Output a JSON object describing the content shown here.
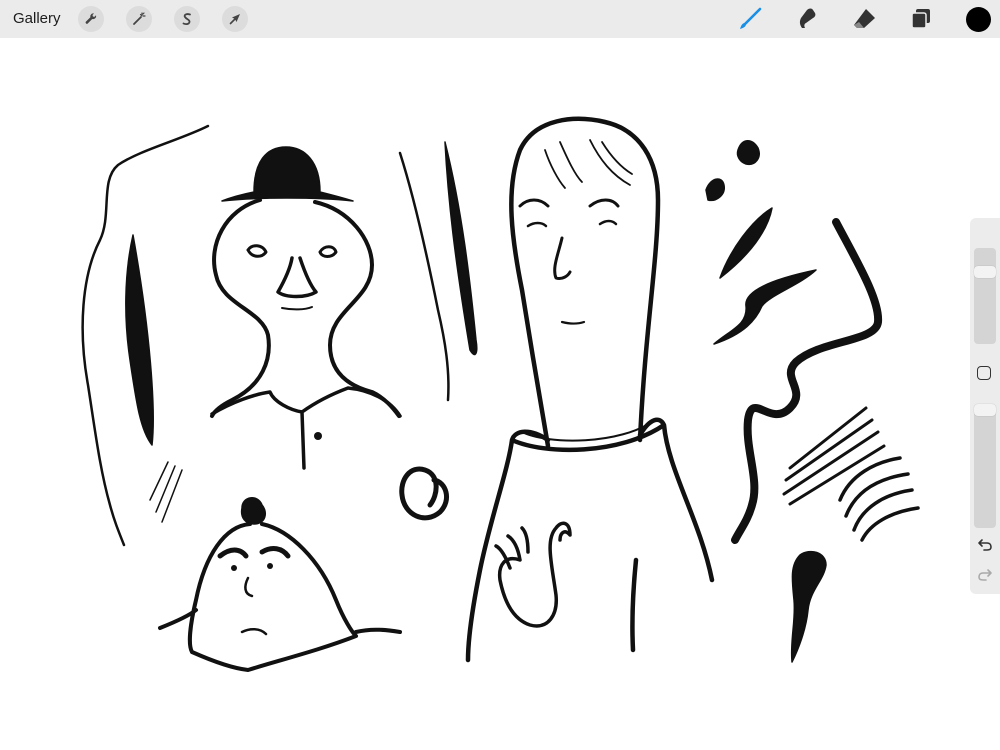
{
  "topbar": {
    "gallery_label": "Gallery",
    "left_tools": [
      {
        "name": "actions",
        "icon": "wrench-icon"
      },
      {
        "name": "adjustments",
        "icon": "magic-wand-icon"
      },
      {
        "name": "selection",
        "icon": "selection-s-icon"
      },
      {
        "name": "transform",
        "icon": "arrow-cursor-icon"
      }
    ],
    "right_tools": [
      {
        "name": "brush",
        "icon": "brush-icon",
        "active": true
      },
      {
        "name": "smudge",
        "icon": "smudge-icon"
      },
      {
        "name": "eraser",
        "icon": "eraser-icon"
      },
      {
        "name": "layers",
        "icon": "layers-icon"
      }
    ],
    "current_color": "#000000",
    "active_tool_color": "#1a8fe6"
  },
  "sidebar": {
    "brush_size_icon": "brush-size-slider",
    "modify_icon": "square-modify-icon",
    "opacity_icon": "opacity-slider",
    "undo_icon": "undo-icon",
    "redo_icon": "redo-icon"
  }
}
